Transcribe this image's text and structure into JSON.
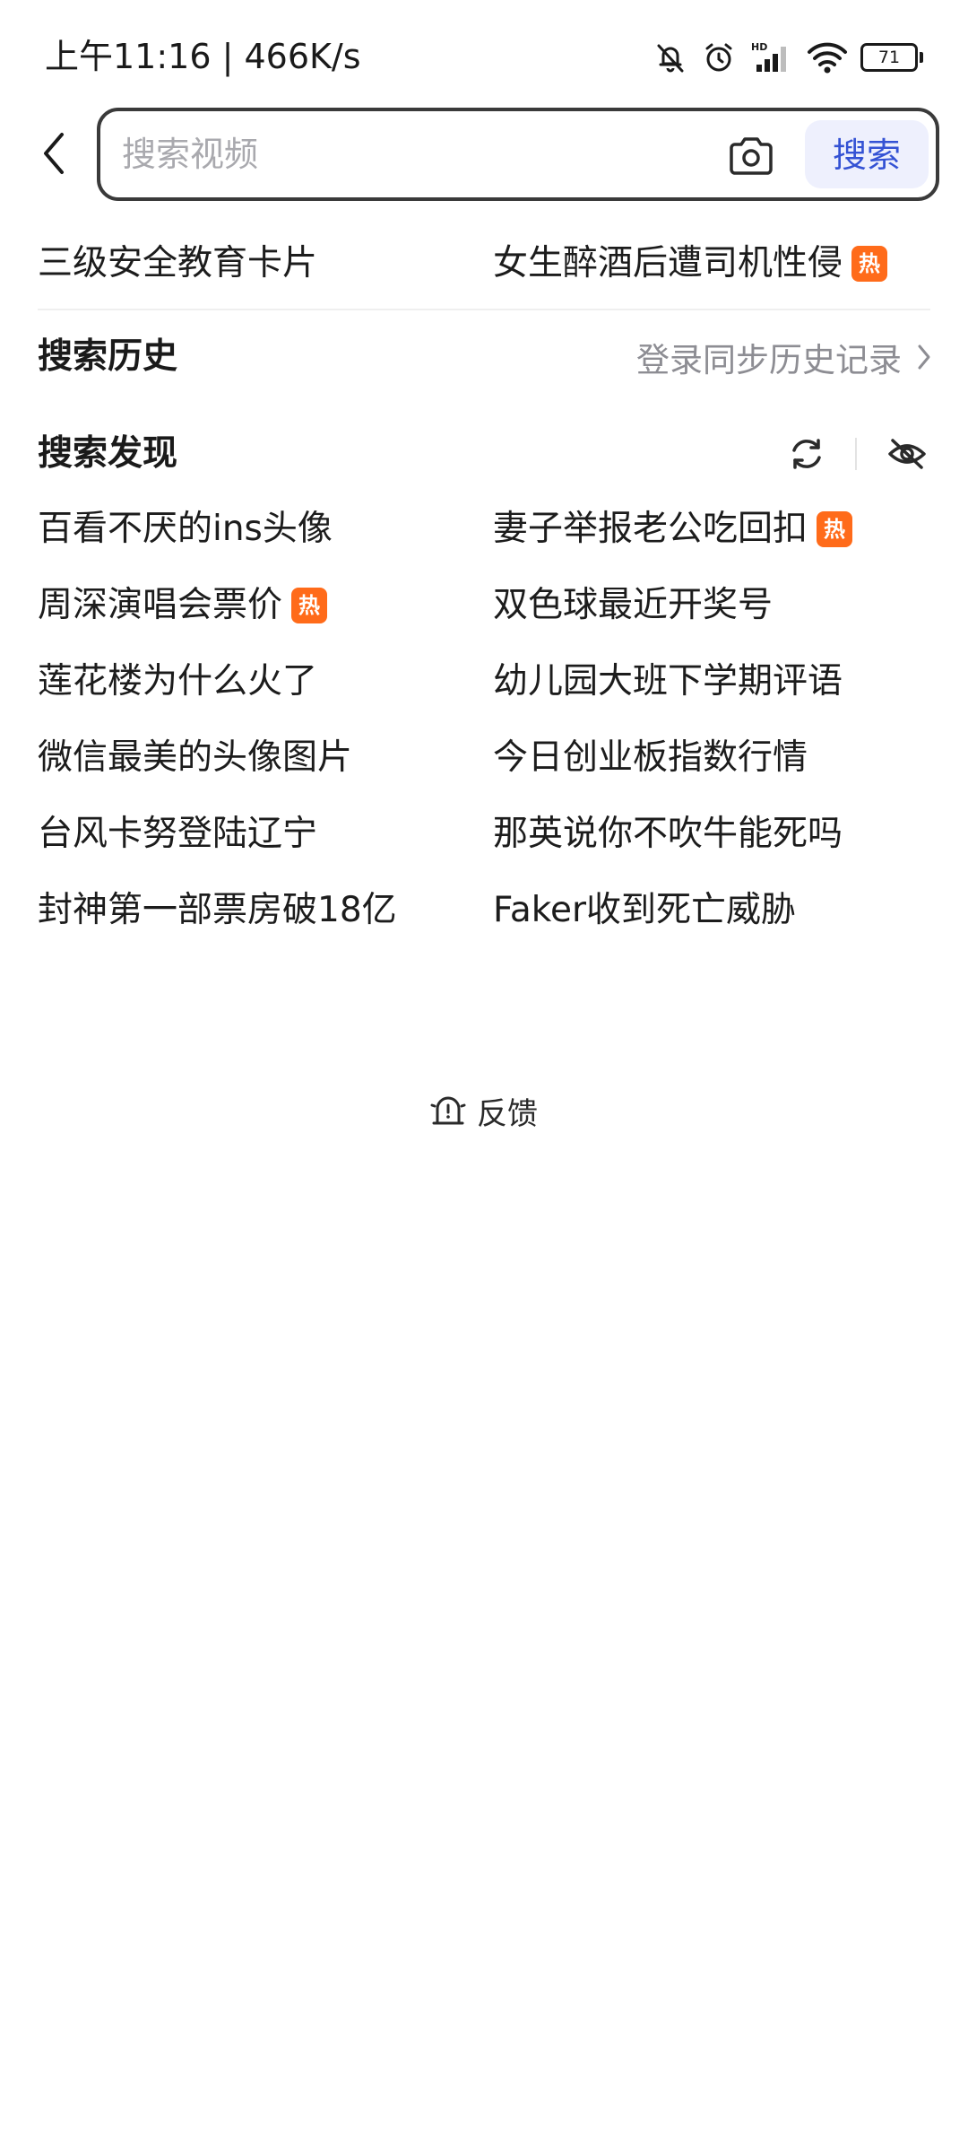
{
  "status_bar": {
    "time_speed": "上午11:16 | 466K/s",
    "battery_level": "71",
    "icons": [
      "bell-off-icon",
      "alarm-icon",
      "hd-signal-icon",
      "wifi-icon",
      "battery-icon"
    ]
  },
  "search": {
    "placeholder": "搜索视频",
    "value": "",
    "button_label": "搜索",
    "accent_color": "#3452d4"
  },
  "suggestions": [
    {
      "label": "三级安全教育卡片",
      "hot": false
    },
    {
      "label": "女生醉酒后遭司机性侵",
      "hot": true
    }
  ],
  "history": {
    "title": "搜索历史",
    "sync_link": "登录同步历史记录"
  },
  "discover": {
    "title": "搜索发现",
    "items": [
      {
        "label": "百看不厌的ins头像",
        "hot": false
      },
      {
        "label": "妻子举报老公吃回扣",
        "hot": true
      },
      {
        "label": "周深演唱会票价",
        "hot": true
      },
      {
        "label": "双色球最近开奖号",
        "hot": false
      },
      {
        "label": "莲花楼为什么火了",
        "hot": false
      },
      {
        "label": "幼儿园大班下学期评语",
        "hot": false
      },
      {
        "label": "微信最美的头像图片",
        "hot": false
      },
      {
        "label": "今日创业板指数行情",
        "hot": false
      },
      {
        "label": "台风卡努登陆辽宁",
        "hot": false
      },
      {
        "label": "那英说你不吹牛能死吗",
        "hot": false
      },
      {
        "label": "封神第一部票房破18亿",
        "hot": false
      },
      {
        "label": "Faker收到死亡威胁",
        "hot": false
      }
    ]
  },
  "hot_badge": {
    "label": "热",
    "color": "#ff6b1a"
  },
  "feedback": {
    "label": "反馈"
  }
}
